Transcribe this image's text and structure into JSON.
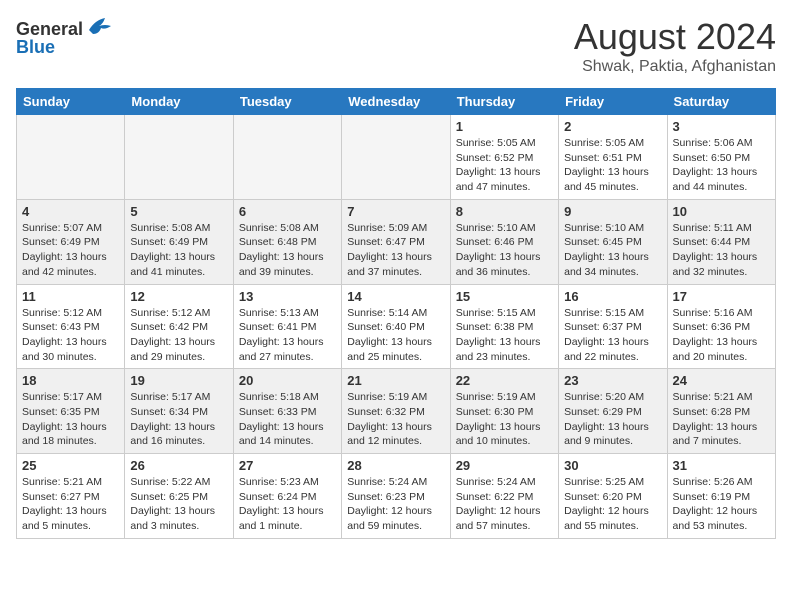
{
  "logo": {
    "general": "General",
    "blue": "Blue"
  },
  "header": {
    "month_year": "August 2024",
    "location": "Shwak, Paktia, Afghanistan"
  },
  "days_of_week": [
    "Sunday",
    "Monday",
    "Tuesday",
    "Wednesday",
    "Thursday",
    "Friday",
    "Saturday"
  ],
  "weeks": [
    {
      "days": [
        {
          "number": "",
          "info": ""
        },
        {
          "number": "",
          "info": ""
        },
        {
          "number": "",
          "info": ""
        },
        {
          "number": "",
          "info": ""
        },
        {
          "number": "1",
          "info": "Sunrise: 5:05 AM\nSunset: 6:52 PM\nDaylight: 13 hours and 47 minutes."
        },
        {
          "number": "2",
          "info": "Sunrise: 5:05 AM\nSunset: 6:51 PM\nDaylight: 13 hours and 45 minutes."
        },
        {
          "number": "3",
          "info": "Sunrise: 5:06 AM\nSunset: 6:50 PM\nDaylight: 13 hours and 44 minutes."
        }
      ]
    },
    {
      "days": [
        {
          "number": "4",
          "info": "Sunrise: 5:07 AM\nSunset: 6:49 PM\nDaylight: 13 hours and 42 minutes."
        },
        {
          "number": "5",
          "info": "Sunrise: 5:08 AM\nSunset: 6:49 PM\nDaylight: 13 hours and 41 minutes."
        },
        {
          "number": "6",
          "info": "Sunrise: 5:08 AM\nSunset: 6:48 PM\nDaylight: 13 hours and 39 minutes."
        },
        {
          "number": "7",
          "info": "Sunrise: 5:09 AM\nSunset: 6:47 PM\nDaylight: 13 hours and 37 minutes."
        },
        {
          "number": "8",
          "info": "Sunrise: 5:10 AM\nSunset: 6:46 PM\nDaylight: 13 hours and 36 minutes."
        },
        {
          "number": "9",
          "info": "Sunrise: 5:10 AM\nSunset: 6:45 PM\nDaylight: 13 hours and 34 minutes."
        },
        {
          "number": "10",
          "info": "Sunrise: 5:11 AM\nSunset: 6:44 PM\nDaylight: 13 hours and 32 minutes."
        }
      ]
    },
    {
      "days": [
        {
          "number": "11",
          "info": "Sunrise: 5:12 AM\nSunset: 6:43 PM\nDaylight: 13 hours and 30 minutes."
        },
        {
          "number": "12",
          "info": "Sunrise: 5:12 AM\nSunset: 6:42 PM\nDaylight: 13 hours and 29 minutes."
        },
        {
          "number": "13",
          "info": "Sunrise: 5:13 AM\nSunset: 6:41 PM\nDaylight: 13 hours and 27 minutes."
        },
        {
          "number": "14",
          "info": "Sunrise: 5:14 AM\nSunset: 6:40 PM\nDaylight: 13 hours and 25 minutes."
        },
        {
          "number": "15",
          "info": "Sunrise: 5:15 AM\nSunset: 6:38 PM\nDaylight: 13 hours and 23 minutes."
        },
        {
          "number": "16",
          "info": "Sunrise: 5:15 AM\nSunset: 6:37 PM\nDaylight: 13 hours and 22 minutes."
        },
        {
          "number": "17",
          "info": "Sunrise: 5:16 AM\nSunset: 6:36 PM\nDaylight: 13 hours and 20 minutes."
        }
      ]
    },
    {
      "days": [
        {
          "number": "18",
          "info": "Sunrise: 5:17 AM\nSunset: 6:35 PM\nDaylight: 13 hours and 18 minutes."
        },
        {
          "number": "19",
          "info": "Sunrise: 5:17 AM\nSunset: 6:34 PM\nDaylight: 13 hours and 16 minutes."
        },
        {
          "number": "20",
          "info": "Sunrise: 5:18 AM\nSunset: 6:33 PM\nDaylight: 13 hours and 14 minutes."
        },
        {
          "number": "21",
          "info": "Sunrise: 5:19 AM\nSunset: 6:32 PM\nDaylight: 13 hours and 12 minutes."
        },
        {
          "number": "22",
          "info": "Sunrise: 5:19 AM\nSunset: 6:30 PM\nDaylight: 13 hours and 10 minutes."
        },
        {
          "number": "23",
          "info": "Sunrise: 5:20 AM\nSunset: 6:29 PM\nDaylight: 13 hours and 9 minutes."
        },
        {
          "number": "24",
          "info": "Sunrise: 5:21 AM\nSunset: 6:28 PM\nDaylight: 13 hours and 7 minutes."
        }
      ]
    },
    {
      "days": [
        {
          "number": "25",
          "info": "Sunrise: 5:21 AM\nSunset: 6:27 PM\nDaylight: 13 hours and 5 minutes."
        },
        {
          "number": "26",
          "info": "Sunrise: 5:22 AM\nSunset: 6:25 PM\nDaylight: 13 hours and 3 minutes."
        },
        {
          "number": "27",
          "info": "Sunrise: 5:23 AM\nSunset: 6:24 PM\nDaylight: 13 hours and 1 minute."
        },
        {
          "number": "28",
          "info": "Sunrise: 5:24 AM\nSunset: 6:23 PM\nDaylight: 12 hours and 59 minutes."
        },
        {
          "number": "29",
          "info": "Sunrise: 5:24 AM\nSunset: 6:22 PM\nDaylight: 12 hours and 57 minutes."
        },
        {
          "number": "30",
          "info": "Sunrise: 5:25 AM\nSunset: 6:20 PM\nDaylight: 12 hours and 55 minutes."
        },
        {
          "number": "31",
          "info": "Sunrise: 5:26 AM\nSunset: 6:19 PM\nDaylight: 12 hours and 53 minutes."
        }
      ]
    }
  ]
}
